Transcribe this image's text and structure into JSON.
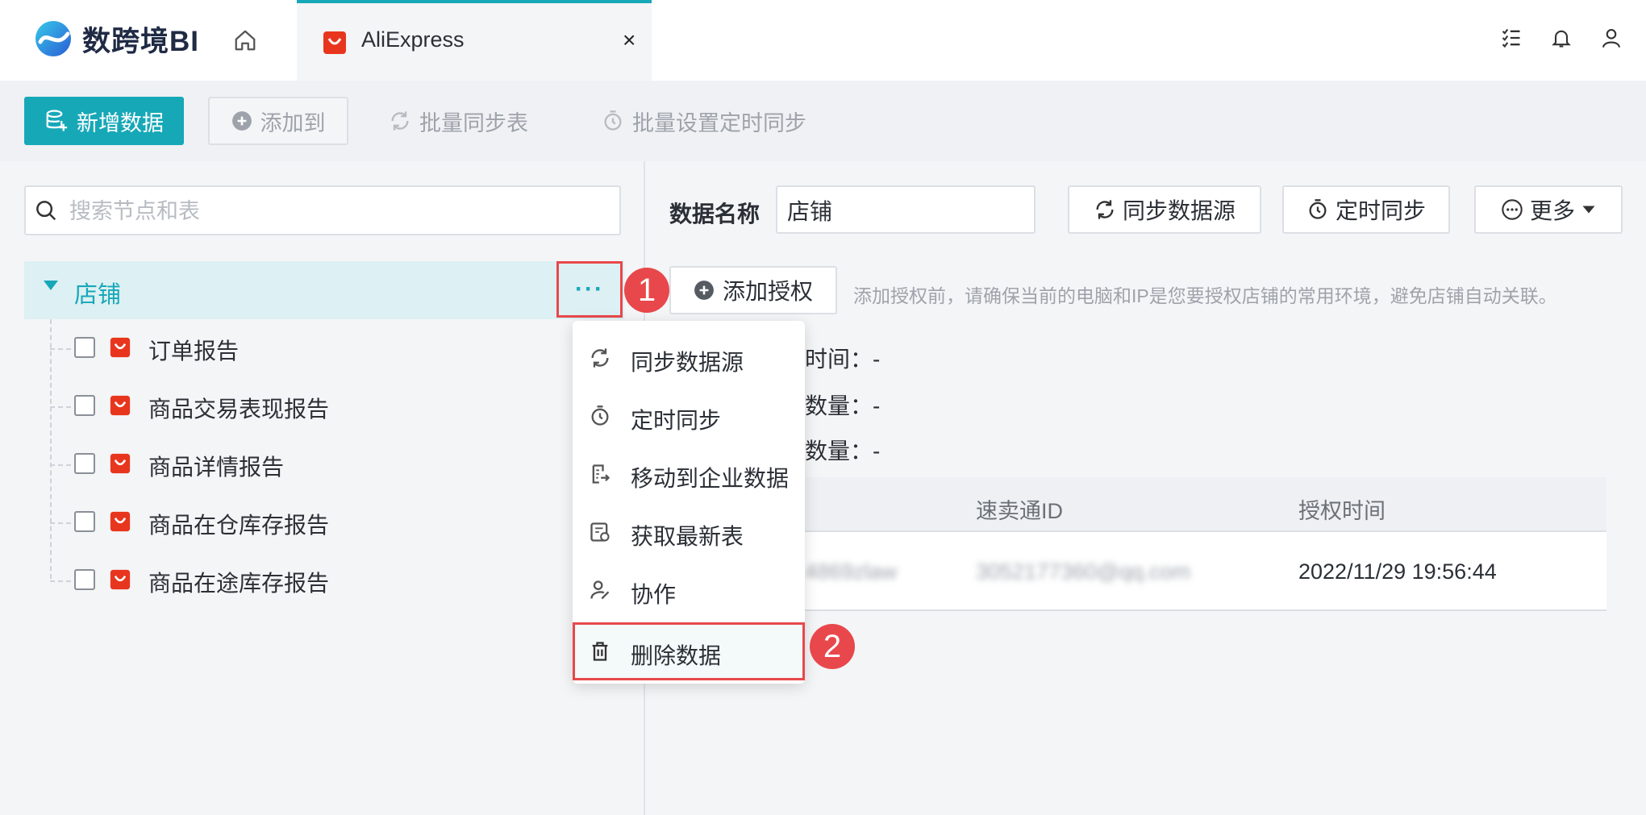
{
  "app": {
    "name": "数跨境BI"
  },
  "tab": {
    "title": "AliExpress",
    "close_label": "×"
  },
  "toolbar": {
    "new_data": "新增数据",
    "add_to": "添加到",
    "batch_sync": "批量同步表",
    "batch_schedule": "批量设置定时同步"
  },
  "search": {
    "placeholder": "搜索节点和表"
  },
  "tree": {
    "root": {
      "label": "店铺",
      "more": "···"
    },
    "items": [
      {
        "label": "订单报告"
      },
      {
        "label": "商品交易表现报告"
      },
      {
        "label": "商品详情报告"
      },
      {
        "label": "商品在仓库存报告"
      },
      {
        "label": "商品在途库存报告"
      }
    ]
  },
  "markers": {
    "one": "1",
    "two": "2"
  },
  "menu": {
    "items": [
      {
        "label": "同步数据源",
        "icon": "sync-icon"
      },
      {
        "label": "定时同步",
        "icon": "timer-icon"
      },
      {
        "label": "移动到企业数据",
        "icon": "move-icon"
      },
      {
        "label": "获取最新表",
        "icon": "refresh-table-icon"
      },
      {
        "label": "协作",
        "icon": "collab-icon"
      },
      {
        "label": "删除数据",
        "icon": "trash-icon"
      }
    ]
  },
  "detail": {
    "data_name_label": "数据名称",
    "data_name_value": "店铺",
    "sync_source": "同步数据源",
    "scheduled_sync": "定时同步",
    "more": "更多",
    "add_auth": "添加授权",
    "auth_note": "添加授权前，请确保当前的电脑和IP是您要授权店铺的常用环境，避免店铺自动关联。",
    "stat1": "时间：-",
    "stat2": "数量：-",
    "stat3": "数量：-"
  },
  "table": {
    "headers": [
      "速卖通ID",
      "授权时间"
    ],
    "rows": [
      {
        "name": "4869zlaw",
        "aliexpress_id": "3052177360@qq.com",
        "auth_time": "2022/11/29 19:56:44"
      }
    ]
  },
  "colors": {
    "accent": "#17a8b8",
    "highlight": "#e8484b",
    "ali": "#e8361e"
  }
}
